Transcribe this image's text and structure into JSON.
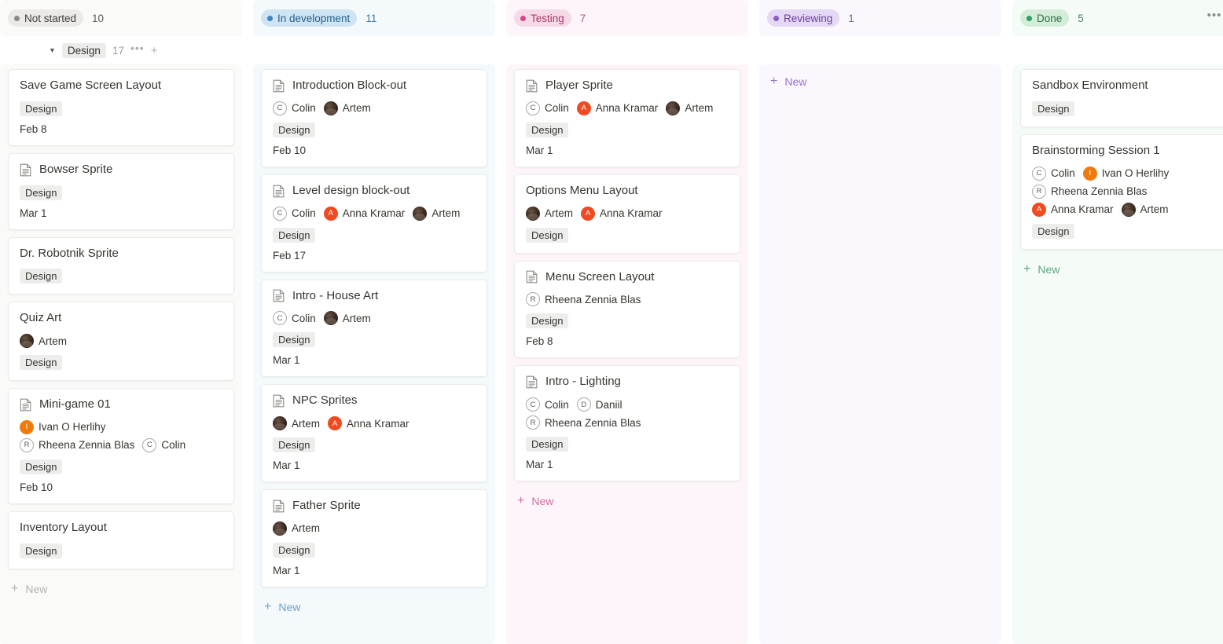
{
  "board": {
    "group": {
      "name": "Design",
      "count": "17",
      "caret_icon": "caret-down-icon",
      "more_icon": "more-options-icon",
      "add_icon": "add-icon"
    },
    "new_label": "New",
    "header_more_icon": "more-options-icon",
    "header_add_icon": "add-icon",
    "columns": [
      {
        "id": "not-started",
        "status": "Not started",
        "count": "10",
        "dot_color": "#8a8a85",
        "chip_bg": "#eceae8",
        "chip_text": "#3f3f3b",
        "body_bg": "#fafaf9",
        "new_color": "#b3b3ad",
        "cards": [
          {
            "title": "Save Game Screen Layout",
            "has_doc_icon": false,
            "people": [],
            "tags": [
              "Design"
            ],
            "date": "Feb 8"
          },
          {
            "title": "Bowser Sprite",
            "has_doc_icon": true,
            "people": [],
            "tags": [
              "Design"
            ],
            "date": "Mar 1"
          },
          {
            "title": "Dr. Robotnik Sprite",
            "has_doc_icon": false,
            "people": [],
            "tags": [
              "Design"
            ],
            "date": ""
          },
          {
            "title": "Quiz Art",
            "has_doc_icon": false,
            "people": [
              {
                "name": "Artem",
                "avatar": "photo",
                "initial": ""
              }
            ],
            "tags": [
              "Design"
            ],
            "date": ""
          },
          {
            "title": "Mini-game 01",
            "has_doc_icon": true,
            "people": [
              {
                "name": "Ivan O Herlihy",
                "avatar": "solid",
                "initial": "I",
                "color": "#ef7b0e"
              },
              {
                "name": "Rheena Zennia Blas",
                "avatar": "outline",
                "initial": "R"
              },
              {
                "name": "Colin",
                "avatar": "outline",
                "initial": "C"
              }
            ],
            "tags": [
              "Design"
            ],
            "date": "Feb 10"
          },
          {
            "title": "Inventory Layout",
            "has_doc_icon": false,
            "people": [],
            "tags": [
              "Design"
            ],
            "date": ""
          }
        ]
      },
      {
        "id": "in-development",
        "status": "In development",
        "count": "11",
        "dot_color": "#3b86c4",
        "chip_bg": "#cfe4f2",
        "chip_text": "#23618f",
        "body_bg": "#f4f9fc",
        "new_color": "#6ba3cc",
        "cards": [
          {
            "title": "Introduction Block-out",
            "has_doc_icon": true,
            "people": [
              {
                "name": "Colin",
                "avatar": "outline",
                "initial": "C"
              },
              {
                "name": "Artem",
                "avatar": "photo",
                "initial": ""
              }
            ],
            "tags": [
              "Design"
            ],
            "date": "Feb 10"
          },
          {
            "title": "Level design block-out",
            "has_doc_icon": true,
            "people": [
              {
                "name": "Colin",
                "avatar": "outline",
                "initial": "C"
              },
              {
                "name": "Anna Kramar",
                "avatar": "solid",
                "initial": "A",
                "color": "#f04a21"
              },
              {
                "name": "Artem",
                "avatar": "photo",
                "initial": ""
              }
            ],
            "tags": [
              "Design"
            ],
            "date": "Feb 17"
          },
          {
            "title": "Intro - House Art",
            "has_doc_icon": true,
            "people": [
              {
                "name": "Colin",
                "avatar": "outline",
                "initial": "C"
              },
              {
                "name": "Artem",
                "avatar": "photo",
                "initial": ""
              }
            ],
            "tags": [
              "Design"
            ],
            "date": "Mar 1"
          },
          {
            "title": "NPC Sprites",
            "has_doc_icon": true,
            "people": [
              {
                "name": "Artem",
                "avatar": "photo",
                "initial": ""
              },
              {
                "name": "Anna Kramar",
                "avatar": "solid",
                "initial": "A",
                "color": "#f04a21"
              }
            ],
            "tags": [
              "Design"
            ],
            "date": "Mar 1"
          },
          {
            "title": "Father Sprite",
            "has_doc_icon": true,
            "people": [
              {
                "name": "Artem",
                "avatar": "photo",
                "initial": ""
              }
            ],
            "tags": [
              "Design"
            ],
            "date": "Mar 1"
          }
        ]
      },
      {
        "id": "testing",
        "status": "Testing",
        "count": "7",
        "dot_color": "#d2498b",
        "chip_bg": "#f6d9e6",
        "chip_text": "#a8396c",
        "body_bg": "#fdf5f9",
        "new_color": "#d06fa3",
        "cards": [
          {
            "title": "Player Sprite",
            "has_doc_icon": true,
            "people": [
              {
                "name": "Colin",
                "avatar": "outline",
                "initial": "C"
              },
              {
                "name": "Anna Kramar",
                "avatar": "solid",
                "initial": "A",
                "color": "#f04a21"
              },
              {
                "name": "Artem",
                "avatar": "photo",
                "initial": ""
              }
            ],
            "tags": [
              "Design"
            ],
            "date": "Mar 1"
          },
          {
            "title": "Options Menu Layout",
            "has_doc_icon": false,
            "people": [
              {
                "name": "Artem",
                "avatar": "photo",
                "initial": ""
              },
              {
                "name": "Anna Kramar",
                "avatar": "solid",
                "initial": "A",
                "color": "#f04a21"
              }
            ],
            "tags": [
              "Design"
            ],
            "date": ""
          },
          {
            "title": "Menu Screen Layout",
            "has_doc_icon": true,
            "people": [
              {
                "name": "Rheena Zennia Blas",
                "avatar": "outline",
                "initial": "R"
              }
            ],
            "tags": [
              "Design"
            ],
            "date": "Feb 8"
          },
          {
            "title": "Intro - Lighting",
            "has_doc_icon": true,
            "people": [
              {
                "name": "Colin",
                "avatar": "outline",
                "initial": "C"
              },
              {
                "name": "Daniil",
                "avatar": "outline",
                "initial": "D"
              },
              {
                "name": "Rheena Zennia Blas",
                "avatar": "outline",
                "initial": "R"
              }
            ],
            "tags": [
              "Design"
            ],
            "date": "Mar 1"
          }
        ]
      },
      {
        "id": "reviewing",
        "status": "Reviewing",
        "count": "1",
        "dot_color": "#8b5cc4",
        "chip_bg": "#e4d8f4",
        "chip_text": "#6b3fa0",
        "body_bg": "#faf7fd",
        "new_color": "#9b72cf",
        "cards": []
      },
      {
        "id": "done",
        "status": "Done",
        "count": "5",
        "dot_color": "#2f9e62",
        "chip_bg": "#d4edd9",
        "chip_text": "#2a7049",
        "body_bg": "#f5fbf7",
        "new_color": "#5aa87c",
        "cards": [
          {
            "title": "Sandbox Environment",
            "has_doc_icon": false,
            "people": [],
            "tags": [
              "Design"
            ],
            "date": ""
          },
          {
            "title": "Brainstorming Session 1",
            "has_doc_icon": false,
            "people": [
              {
                "name": "Colin",
                "avatar": "outline",
                "initial": "C"
              },
              {
                "name": "Ivan O Herlihy",
                "avatar": "solid",
                "initial": "I",
                "color": "#ef7b0e"
              },
              {
                "name": "Rheena Zennia Blas",
                "avatar": "outline",
                "initial": "R"
              },
              {
                "name": "Anna Kramar",
                "avatar": "solid",
                "initial": "A",
                "color": "#f04a21"
              },
              {
                "name": "Artem",
                "avatar": "photo",
                "initial": ""
              }
            ],
            "tags": [
              "Design"
            ],
            "date": ""
          }
        ]
      }
    ]
  }
}
